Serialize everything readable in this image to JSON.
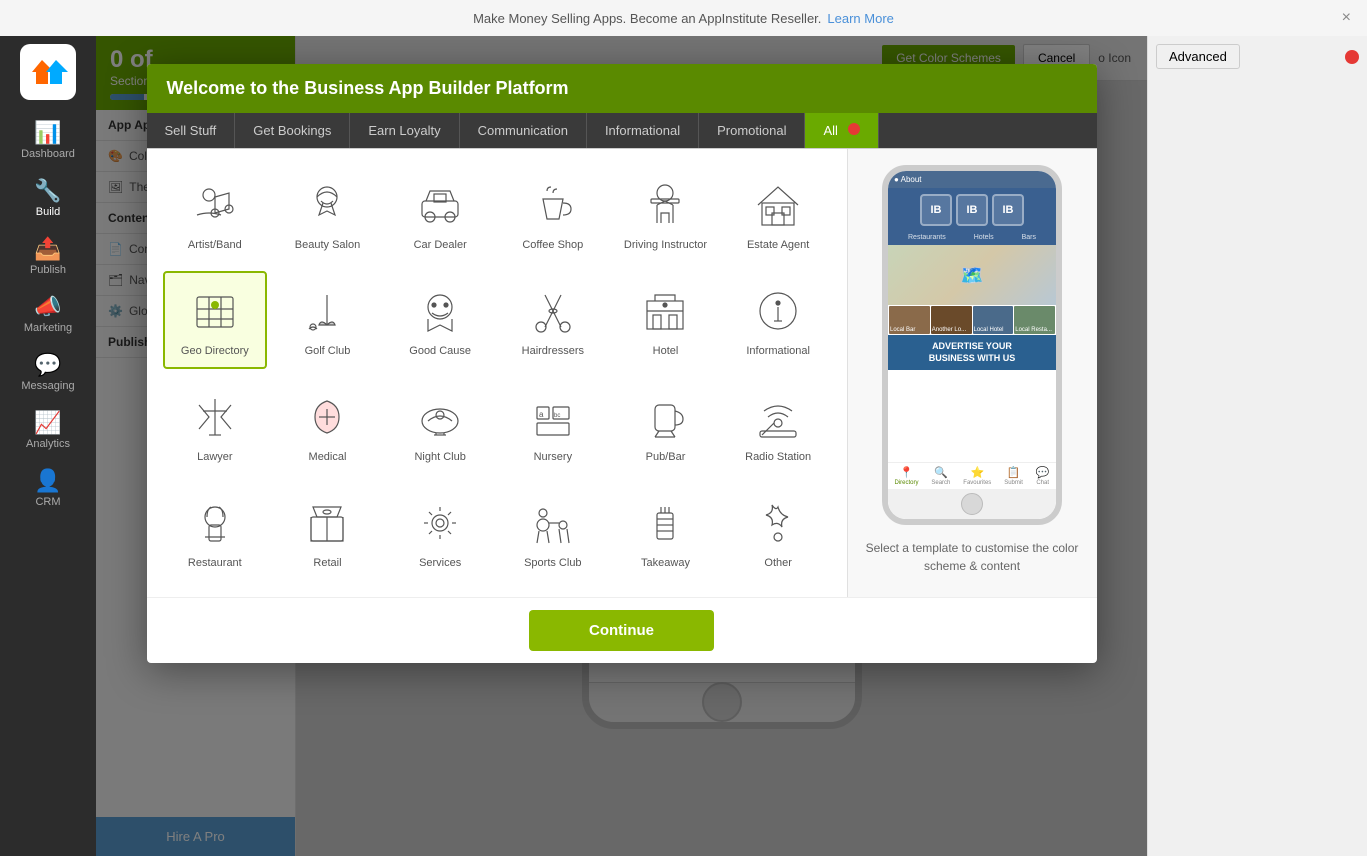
{
  "topBanner": {
    "text": "Make Money Selling Apps. Become an AppInstitute Reseller.",
    "linkText": "Learn More",
    "closeLabel": "×"
  },
  "sidebar": {
    "items": [
      {
        "id": "dashboard",
        "label": "Dashboard",
        "icon": "📊"
      },
      {
        "id": "build",
        "label": "Build",
        "icon": "🔧"
      },
      {
        "id": "publish",
        "label": "Publish",
        "icon": "📤"
      },
      {
        "id": "marketing",
        "label": "Marketing",
        "icon": "📣"
      },
      {
        "id": "messaging",
        "label": "Messaging",
        "icon": "💬"
      },
      {
        "id": "analytics",
        "label": "Analytics",
        "icon": "📈"
      },
      {
        "id": "crm",
        "label": "CRM",
        "icon": "👤"
      }
    ]
  },
  "rightPanel": {
    "advancedLabel": "Advanced",
    "colors": [
      {
        "swatch": "#8ab800",
        "bar": "#8ab800"
      },
      {
        "swatch": "#6688aa",
        "bar": "#c8d8e8"
      },
      {
        "swatch": "#556677",
        "bar": "#aabbcc"
      },
      {
        "swatch": "#334455",
        "bar": "#2266cc"
      }
    ]
  },
  "contentArea": {
    "sectionsLabel": "0 of",
    "sectionsSubLabel": "Sections Co...",
    "appAppearanceLabel": "App Appearance",
    "colorSchemeLabel": "Color Sche...",
    "themeImgLabel": "Theme Im...",
    "contentSettingsLabel": "Content & Setti...",
    "contentLabel": "Content",
    "navigationLabel": "Navigation",
    "globalSettingsLabel": "Global Se...",
    "publishLabel": "Publish",
    "hireProLabel": "Hire A Pro",
    "getColorSchemesLabel": "Get Color Schemes",
    "cancelLabel": "Cancel",
    "appIconLabel": "o Icon"
  },
  "modal": {
    "title": "Welcome to the Business App Builder Platform",
    "tabs": [
      {
        "id": "sell-stuff",
        "label": "Sell Stuff",
        "active": false
      },
      {
        "id": "get-bookings",
        "label": "Get Bookings",
        "active": false
      },
      {
        "id": "earn-loyalty",
        "label": "Earn Loyalty",
        "active": false
      },
      {
        "id": "communication",
        "label": "Communication",
        "active": false
      },
      {
        "id": "informational",
        "label": "Informational",
        "active": false
      },
      {
        "id": "promotional",
        "label": "Promotional",
        "active": false
      },
      {
        "id": "all",
        "label": "All",
        "active": true
      }
    ],
    "templates": [
      {
        "id": "artist-band",
        "name": "Artist/Band",
        "icon": "🤘",
        "selected": false
      },
      {
        "id": "beauty-salon",
        "name": "Beauty Salon",
        "icon": "💐",
        "selected": false
      },
      {
        "id": "car-dealer",
        "name": "Car Dealer",
        "icon": "🚗",
        "selected": false
      },
      {
        "id": "coffee-shop",
        "name": "Coffee Shop",
        "icon": "☕",
        "selected": false
      },
      {
        "id": "driving-instructor",
        "name": "Driving Instructor",
        "icon": "🧑",
        "selected": false
      },
      {
        "id": "estate-agent",
        "name": "Estate Agent",
        "icon": "🏠",
        "selected": false
      },
      {
        "id": "geo-directory",
        "name": "Geo Directory",
        "icon": "🗺️",
        "selected": true
      },
      {
        "id": "golf-club",
        "name": "Golf Club",
        "icon": "⛳",
        "selected": false
      },
      {
        "id": "good-cause",
        "name": "Good Cause",
        "icon": "😊",
        "selected": false
      },
      {
        "id": "hairdressers",
        "name": "Hairdressers",
        "icon": "✂️",
        "selected": false
      },
      {
        "id": "hotel",
        "name": "Hotel",
        "icon": "🧳",
        "selected": false
      },
      {
        "id": "informational",
        "name": "Informational",
        "icon": "🌍",
        "selected": false
      },
      {
        "id": "lawyer",
        "name": "Lawyer",
        "icon": "🔨",
        "selected": false
      },
      {
        "id": "medical",
        "name": "Medical",
        "icon": "❤️",
        "selected": false
      },
      {
        "id": "night-club",
        "name": "Night Club",
        "icon": "🎭",
        "selected": false
      },
      {
        "id": "nursery",
        "name": "Nursery",
        "icon": "🔤",
        "selected": false
      },
      {
        "id": "pub-bar",
        "name": "Pub/Bar",
        "icon": "🍺",
        "selected": false
      },
      {
        "id": "radio-station",
        "name": "Radio Station",
        "icon": "🎵",
        "selected": false
      },
      {
        "id": "restaurant",
        "name": "Restaurant",
        "icon": "👨‍🍳",
        "selected": false
      },
      {
        "id": "retail",
        "name": "Retail",
        "icon": "👛",
        "selected": false
      },
      {
        "id": "services",
        "name": "Services",
        "icon": "⚙️",
        "selected": false
      },
      {
        "id": "sports-club",
        "name": "Sports Club",
        "icon": "🚴",
        "selected": false
      },
      {
        "id": "takeaway",
        "name": "Takeaway",
        "icon": "🍟",
        "selected": false
      },
      {
        "id": "other",
        "name": "Other",
        "icon": "❓",
        "selected": false
      }
    ],
    "continueLabel": "Continue",
    "preview": {
      "caption": "Select a template to customise the color scheme & content"
    }
  }
}
